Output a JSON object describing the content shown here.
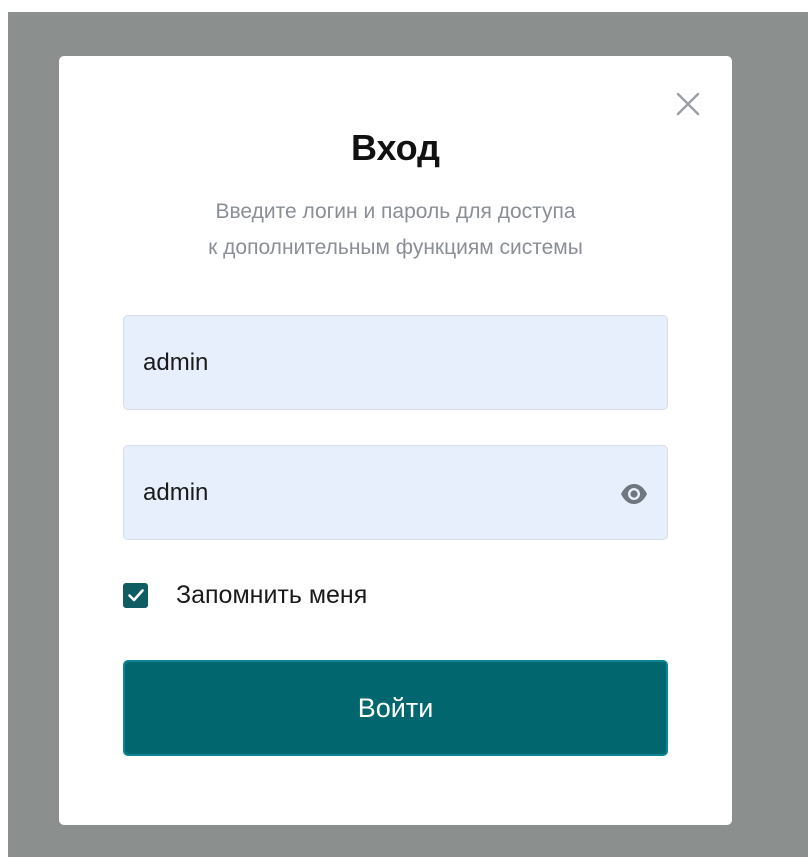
{
  "dialog": {
    "title": "Вход",
    "subtitle_line1": "Введите логин и пароль для доступа",
    "subtitle_line2": "к дополнительным функциям системы",
    "close_icon": "close-icon"
  },
  "form": {
    "login_value": "admin",
    "password_value": "admin",
    "password_toggle_icon": "eye-icon",
    "remember_label": "Запомнить меня",
    "remember_checked": true,
    "submit_label": "Войти"
  },
  "colors": {
    "backdrop": "#8b908f",
    "input_background": "#e8effc",
    "accent": "#02666e",
    "subtitle_text": "#8a8f96"
  }
}
